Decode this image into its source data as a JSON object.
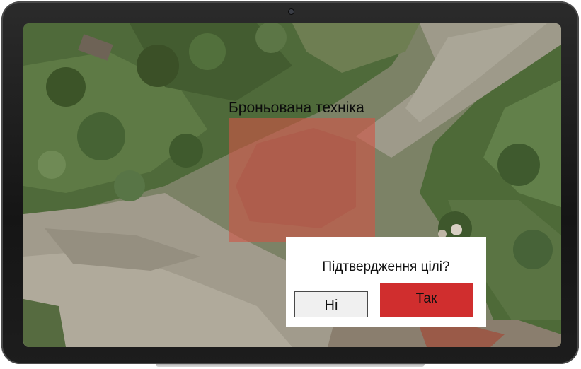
{
  "screen": {
    "target_label": "Броньована техніка",
    "highlight_color": "#ce5646"
  },
  "dialog": {
    "title": "Підтвердження цілі?",
    "no_label": "Ні",
    "yes_label": "Так",
    "yes_color": "#d02e2e",
    "no_color": "#f0f0f0"
  },
  "device": {
    "frame_color": "#1d1d1d"
  }
}
